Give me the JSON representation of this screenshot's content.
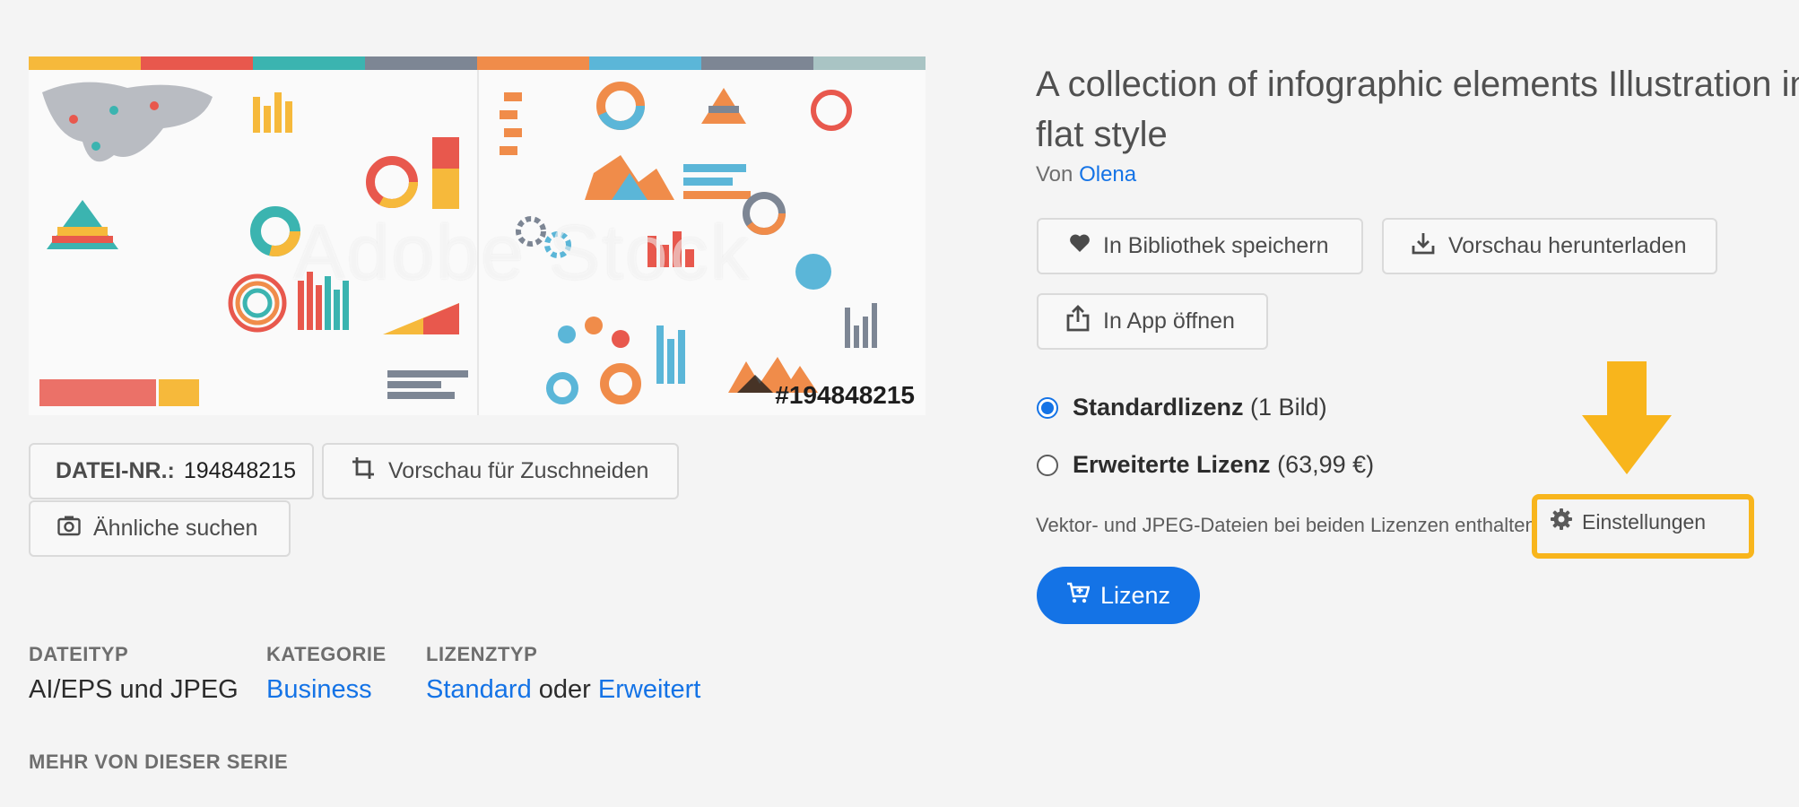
{
  "preview": {
    "watermark": "Adobe Stock",
    "asset_id_overlay": "#194848215"
  },
  "file_info": {
    "label": "DATEI-NR.:",
    "value": "194848215"
  },
  "actions_left": {
    "crop_preview_label": "Vorschau für Zuschneiden",
    "similar_label": "Ähnliche suchen"
  },
  "meta": {
    "filetype_label": "DATEITYP",
    "filetype_value": "AI/EPS und JPEG",
    "category_label": "KATEGORIE",
    "category_value": "Business",
    "license_type_label": "LIZENZTYP",
    "license_standard": "Standard",
    "license_or": "oder",
    "license_extended": "Erweitert",
    "series_label": "MEHR VON DIESER SERIE"
  },
  "title": {
    "line1": "A collection of infographic elements Illustration in",
    "line2": "flat style"
  },
  "byline": {
    "prefix": "Von",
    "author": "Olena"
  },
  "actions_right": {
    "save_library_label": "In Bibliothek speichern",
    "download_preview_label": "Vorschau herunterladen",
    "open_in_app_label": "In App öffnen"
  },
  "licenses": {
    "standard_title": "Standardlizenz",
    "standard_sub": "(1 Bild)",
    "extended_title": "Erweiterte Lizenz",
    "extended_sub": "(63,99 €)",
    "selected": "standard",
    "note": "Vektor- und JPEG-Dateien bei beiden Lizenzen enthalten",
    "settings_label": "Einstellungen",
    "buy_label": "Lizenz"
  },
  "annotation": {
    "arrow_color": "#f8b51c",
    "highlight_color": "#f8b51c"
  },
  "colors": {
    "accent": "#1473e6",
    "background": "#f4f4f4"
  },
  "icons": {
    "heart": "heart-icon",
    "download": "download-icon",
    "share": "share-icon",
    "crop": "crop-icon",
    "camera": "camera-icon",
    "gear": "gear-icon",
    "cart": "cart-icon"
  }
}
